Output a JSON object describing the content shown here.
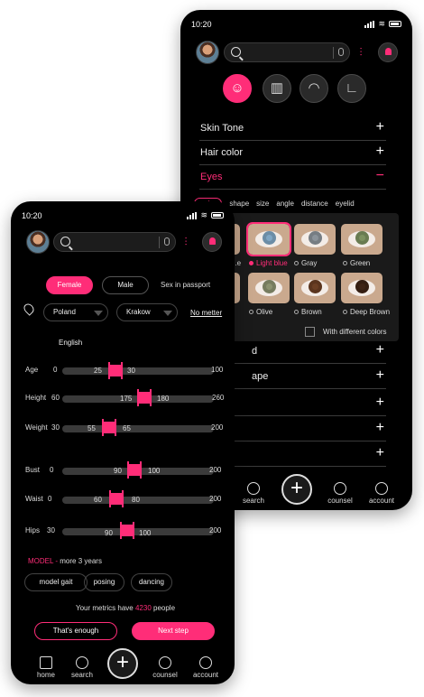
{
  "back": {
    "status": {
      "time": "10:20"
    },
    "sections_top": [
      {
        "label": "Skin Tone",
        "sign": "+"
      },
      {
        "label": "Hair  color",
        "sign": "+"
      },
      {
        "label": "Eyes",
        "sign": "−"
      }
    ],
    "subtabs": [
      "color",
      "shape",
      "size",
      "angle",
      "distance",
      "eyelid"
    ],
    "eye_colors": [
      {
        "label": "...e",
        "iris": "#6b4a33"
      },
      {
        "label": "Light blue",
        "iris": "#7fa6c4",
        "selected": true
      },
      {
        "label": "Gray",
        "iris": "#8b939a"
      },
      {
        "label": "Green",
        "iris": "#7c9160"
      },
      {
        "label": "",
        "iris": "#5a3b28"
      },
      {
        "label": "Olive",
        "iris": "#8b9270"
      },
      {
        "label": "Brown",
        "iris": "#6b3f24"
      },
      {
        "label": "Deep Brown",
        "iris": "#3e2416"
      }
    ],
    "with_different_colors": "With different colors",
    "sections_bottom": [
      {
        "label": "d",
        "sign": "+"
      },
      {
        "label": "ape",
        "sign": "+"
      },
      {
        "label": "",
        "sign": "+"
      },
      {
        "label": "",
        "sign": "+"
      },
      {
        "label": "",
        "sign": "+"
      }
    ],
    "nav": {
      "search": "search",
      "counsel": "counsel",
      "account": "account"
    }
  },
  "front": {
    "status": {
      "time": "10:20"
    },
    "gender": {
      "female": "Female",
      "male": "Male",
      "passport": "Sex in passport"
    },
    "country": "Poland",
    "city": "Krakow",
    "no_metter": "No metter",
    "language": "English",
    "ranges": [
      {
        "label": "Age",
        "min": "0",
        "max": "100",
        "low": "25",
        "high": "30"
      },
      {
        "label": "Height",
        "min": "60",
        "max": "260",
        "low": "175",
        "high": "180"
      },
      {
        "label": "Weight",
        "min": "30",
        "max": "200",
        "low": "55",
        "high": "65"
      },
      {
        "label": "Bust",
        "min": "0",
        "max": "200",
        "low": "90",
        "high": "100"
      },
      {
        "label": "Waist",
        "min": "0",
        "max": "200",
        "low": "60",
        "high": "80"
      },
      {
        "label": "Hips",
        "min": "30",
        "max": "200",
        "low": "90",
        "high": "100"
      }
    ],
    "model_label": "MODEL",
    "model_dash": " - ",
    "model_duration": "more 3 years",
    "skills": [
      "model gait",
      "posing",
      "dancing"
    ],
    "metrics_prefix": "Your metrics have",
    "metrics_count": "4230",
    "metrics_suffix": "people",
    "btn_enough": "That's enough",
    "btn_next": "Next step",
    "nav": {
      "home": "home",
      "search": "search",
      "counsel": "counsel",
      "account": "account"
    }
  },
  "colors": {
    "accent": "#ff2d78",
    "background": "#000000"
  }
}
